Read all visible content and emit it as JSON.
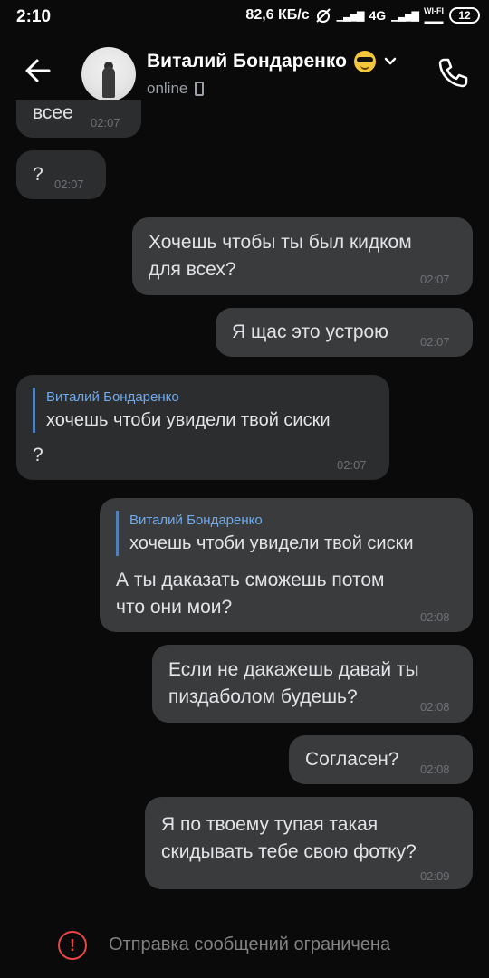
{
  "status_bar": {
    "time": "2:10",
    "speed": "82,6 КБ/с",
    "network": "4G",
    "wifi_label": "WI-FI",
    "battery": "12"
  },
  "header": {
    "contact_name": "Виталий Бондаренко",
    "presence": "online",
    "emoji_icon": "sunglasses-emoji"
  },
  "messages": [
    {
      "dir": "in",
      "text": "всее",
      "time": "02:07"
    },
    {
      "dir": "in",
      "text": "?",
      "time": "02:07"
    },
    {
      "dir": "out",
      "text_lines": [
        "Хочешь чтобы ты был кидком",
        "для всех?"
      ],
      "time": "02:07"
    },
    {
      "dir": "out",
      "text": "Я щас это устрою",
      "time": "02:07"
    },
    {
      "dir": "in",
      "reply_name": "Виталий Бондаренко",
      "reply_text": "хочешь чтоби увидели твой сиски",
      "text": "?",
      "time": "02:07"
    },
    {
      "dir": "out",
      "reply_name": "Виталий Бондаренко",
      "reply_text": "хочешь чтоби увидели твой сиски",
      "text_lines": [
        "А ты даказать сможешь потом",
        "что они мои?"
      ],
      "time": "02:08"
    },
    {
      "dir": "out",
      "text_lines": [
        "Если не дакажешь давай ты",
        "пиздаболом будешь?"
      ],
      "time": "02:08"
    },
    {
      "dir": "out",
      "text": "Согласен?",
      "time": "02:08"
    },
    {
      "dir": "out",
      "text_lines": [
        "Я по твоему тупая такая",
        "скидывать тебе свою фотку?"
      ],
      "time": "02:09"
    }
  ],
  "footer": {
    "notice": "Отправка сообщений ограничена"
  },
  "colors": {
    "background": "#0a0a0a",
    "bubble_in": "#2c2d2e",
    "bubble_out": "#3a3b3c",
    "reply_name": "#71aaeb",
    "warning": "#e64646"
  }
}
